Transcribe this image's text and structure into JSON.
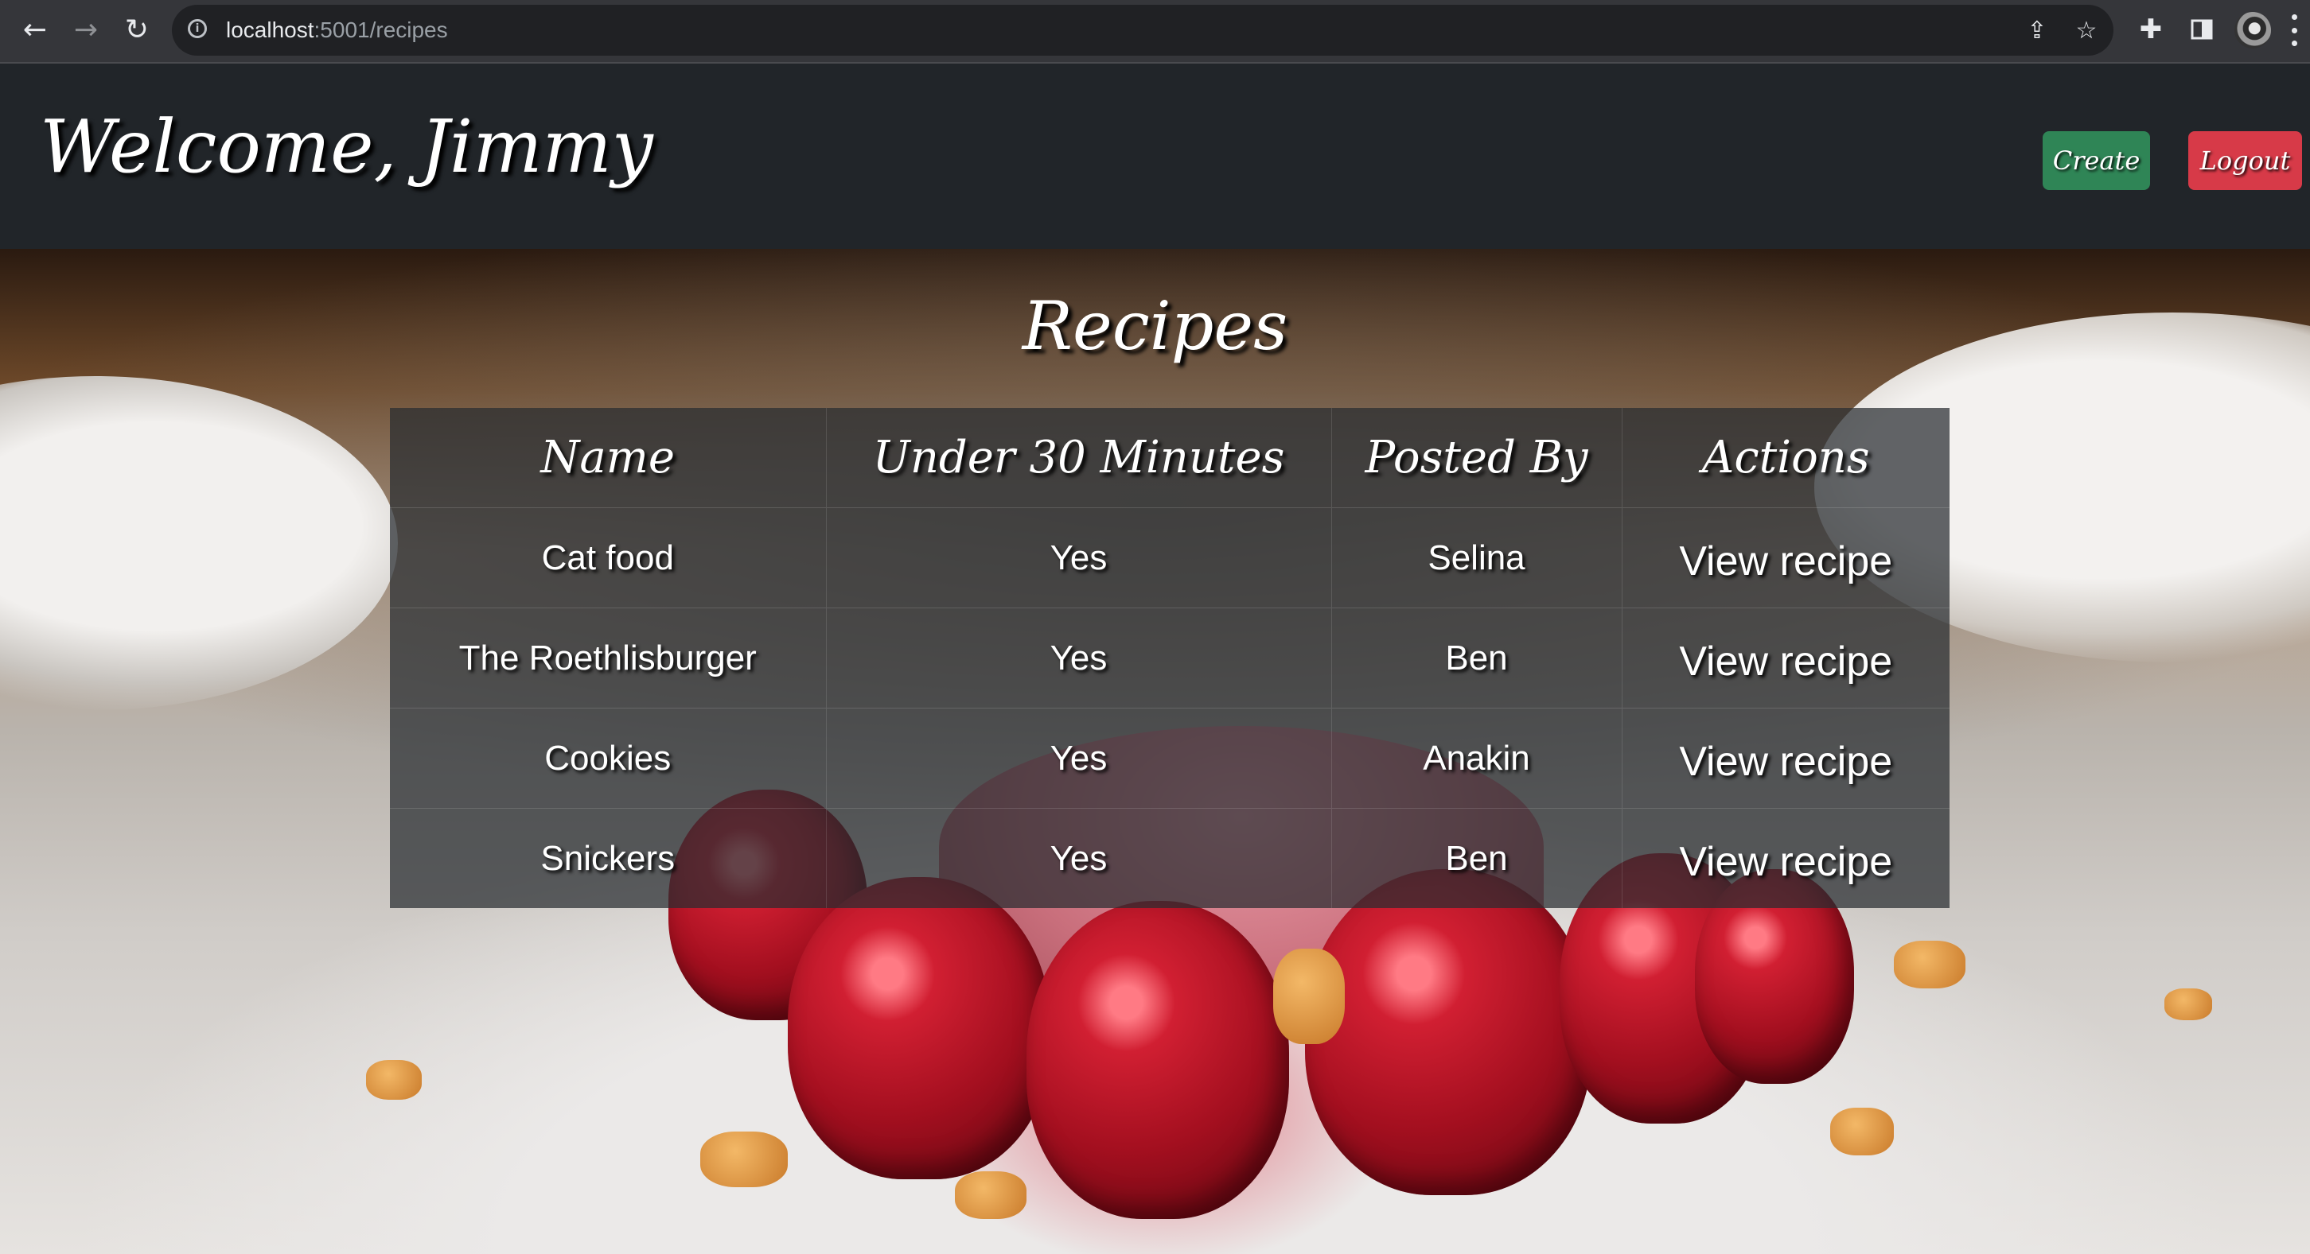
{
  "browser": {
    "url_host": "localhost",
    "url_path": ":5001/recipes",
    "icons": {
      "back": "arrow-left-icon",
      "forward": "arrow-right-icon",
      "reload": "reload-icon",
      "info": "info-icon",
      "share": "share-icon",
      "bookmark": "star-icon",
      "extensions": "puzzle-icon",
      "sidebar": "side-panel-icon",
      "profile": "avatar",
      "menu": "kebab-menu-icon"
    }
  },
  "header": {
    "welcome": "Welcome, Jimmy",
    "create_label": "Create",
    "logout_label": "Logout"
  },
  "colors": {
    "header_bg": "#212529",
    "create_button": "#2f8556",
    "logout_button": "#d73a48",
    "table_bg": "rgba(40,44,48,0.72)"
  },
  "page": {
    "title": "Recipes"
  },
  "table": {
    "columns": [
      "Name",
      "Under 30 Minutes",
      "Posted By",
      "Actions"
    ],
    "rows": [
      {
        "name": "Cat food",
        "under_30": "Yes",
        "posted_by": "Selina",
        "action": "View recipe"
      },
      {
        "name": "The Roethlisburger",
        "under_30": "Yes",
        "posted_by": "Ben",
        "action": "View recipe"
      },
      {
        "name": "Cookies",
        "under_30": "Yes",
        "posted_by": "Anakin",
        "action": "View recipe"
      },
      {
        "name": "Snickers",
        "under_30": "Yes",
        "posted_by": "Ben",
        "action": "View recipe"
      }
    ]
  }
}
